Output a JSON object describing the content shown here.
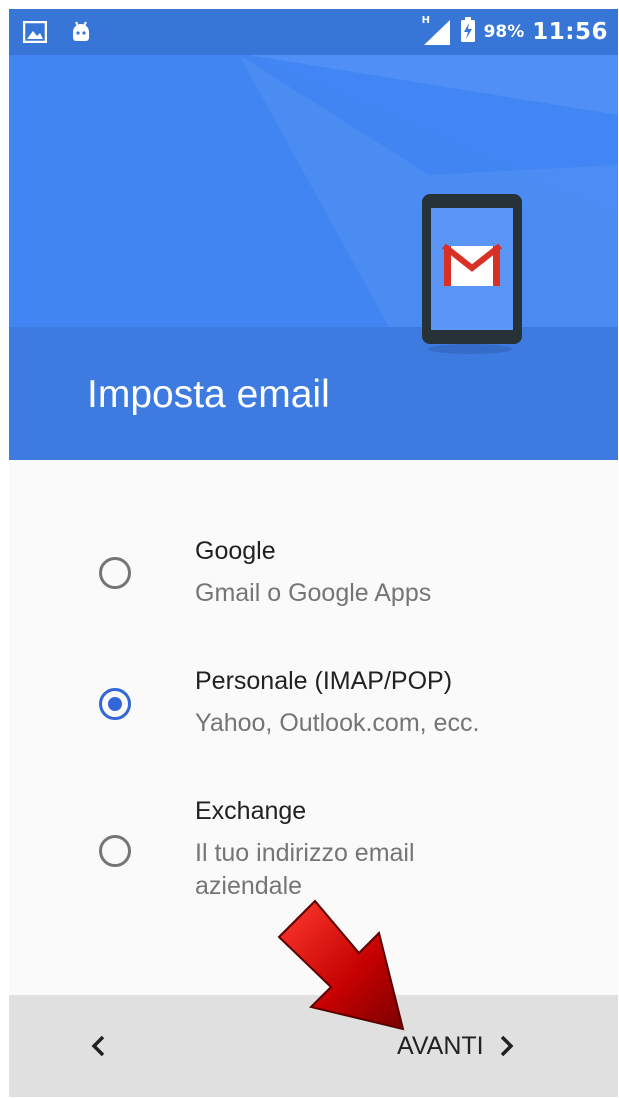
{
  "status_bar": {
    "network_label": "H",
    "battery_percent": "98%",
    "time": "11:56"
  },
  "header": {
    "title": "Imposta email"
  },
  "options": [
    {
      "title": "Google",
      "subtitle": "Gmail o Google Apps",
      "selected": false
    },
    {
      "title": "Personale (IMAP/POP)",
      "subtitle": "Yahoo, Outlook.com, ecc.",
      "selected": true
    },
    {
      "title": "Exchange",
      "subtitle": "Il tuo indirizzo email aziendale",
      "selected": false
    }
  ],
  "bottom_bar": {
    "back_icon": "chevron-left-icon",
    "next_label": "AVANTI",
    "next_icon": "chevron-right-icon"
  },
  "colors": {
    "status_bar": "#3776d6",
    "header": "#4285f4",
    "radio_selected": "#3367d6",
    "annotation_arrow": "#cc0000"
  }
}
